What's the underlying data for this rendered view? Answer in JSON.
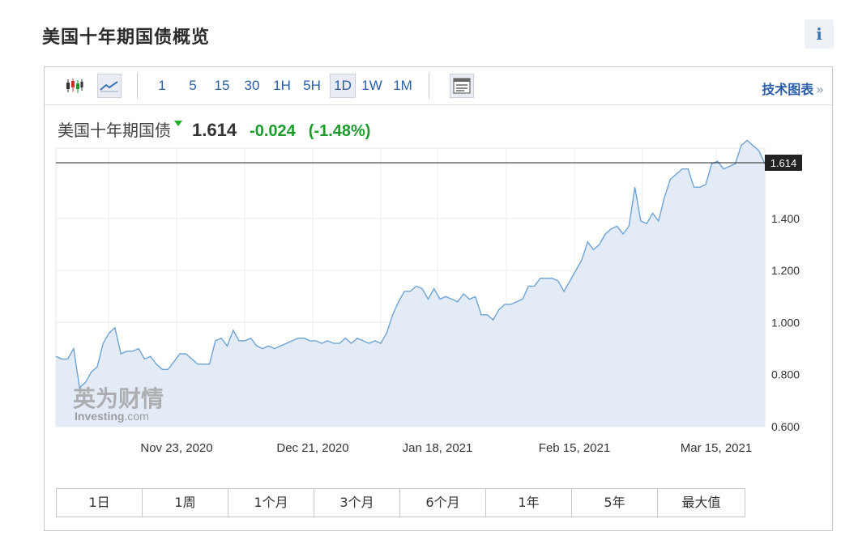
{
  "header": {
    "title": "美国十年期国债概览",
    "info_icon": "info-icon",
    "info_glyph": "i"
  },
  "toolbar": {
    "candlestick_icon": "candlestick-icon",
    "line_icon": "line-chart-icon",
    "intervals": [
      "1",
      "5",
      "15",
      "30",
      "1H",
      "5H",
      "1D",
      "1W",
      "1M"
    ],
    "active_interval": "1D",
    "layout_icon": "table-layout-icon",
    "tech_chart_label": "技术图表",
    "tech_chart_arrow": "»"
  },
  "quote": {
    "name": "美国十年期国债",
    "price": "1.614",
    "change": "-0.024",
    "change_pct": "(-1.48%)"
  },
  "watermark": {
    "brand": "英为财情",
    "sub": "Investing",
    "sub_suffix": ".com"
  },
  "colors": {
    "line": "#6fa3d4",
    "fill": "#e3ecf6",
    "link": "#2a5ea8",
    "down_green": "#1a9c2a"
  },
  "ranges": [
    "1日",
    "1周",
    "1个月",
    "3个月",
    "6个月",
    "1年",
    "5年",
    "最大值"
  ],
  "chart_data": {
    "type": "area",
    "x_ticks": [
      "Nov 23, 2020",
      "Dec 21, 2020",
      "Jan 18, 2021",
      "Feb 15, 2021",
      "Mar 15, 2021"
    ],
    "y_ticks": [
      "0.600",
      "0.800",
      "1.000",
      "1.200",
      "1.400"
    ],
    "ylim": [
      0.6,
      1.67
    ],
    "current_value": 1.614,
    "current_label": "1.614",
    "grid": true,
    "values": [
      0.87,
      0.86,
      0.86,
      0.9,
      0.75,
      0.77,
      0.81,
      0.83,
      0.92,
      0.96,
      0.98,
      0.88,
      0.89,
      0.89,
      0.9,
      0.86,
      0.87,
      0.84,
      0.82,
      0.82,
      0.85,
      0.88,
      0.88,
      0.86,
      0.84,
      0.84,
      0.84,
      0.93,
      0.94,
      0.91,
      0.97,
      0.93,
      0.93,
      0.94,
      0.91,
      0.9,
      0.91,
      0.9,
      0.91,
      0.92,
      0.93,
      0.94,
      0.94,
      0.93,
      0.93,
      0.92,
      0.93,
      0.92,
      0.92,
      0.94,
      0.92,
      0.94,
      0.93,
      0.92,
      0.93,
      0.92,
      0.96,
      1.03,
      1.08,
      1.12,
      1.12,
      1.14,
      1.13,
      1.09,
      1.13,
      1.09,
      1.1,
      1.09,
      1.08,
      1.11,
      1.09,
      1.1,
      1.03,
      1.03,
      1.01,
      1.05,
      1.07,
      1.07,
      1.08,
      1.09,
      1.14,
      1.14,
      1.17,
      1.17,
      1.17,
      1.16,
      1.12,
      1.16,
      1.2,
      1.24,
      1.31,
      1.28,
      1.3,
      1.34,
      1.36,
      1.37,
      1.34,
      1.37,
      1.52,
      1.39,
      1.38,
      1.42,
      1.39,
      1.48,
      1.55,
      1.57,
      1.59,
      1.59,
      1.52,
      1.52,
      1.53,
      1.61,
      1.62,
      1.59,
      1.6,
      1.61,
      1.68,
      1.7,
      1.68,
      1.66,
      1.61
    ]
  }
}
